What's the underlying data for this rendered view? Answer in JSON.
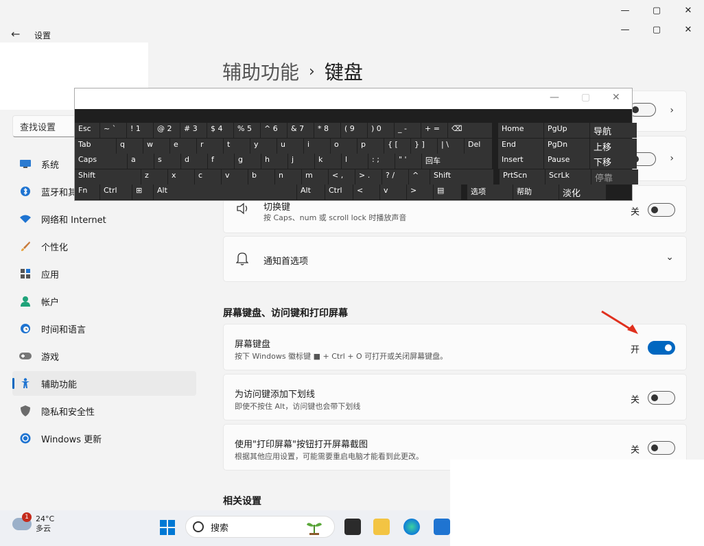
{
  "window": {
    "title": "设置",
    "controls": {
      "minimize": "—",
      "maximize": "▢",
      "close": "✕"
    }
  },
  "sidebar": {
    "search_placeholder": "查找设置",
    "items": [
      {
        "label": "系统",
        "icon": "monitor-icon"
      },
      {
        "label": "蓝牙和其",
        "icon": "bluetooth-icon"
      },
      {
        "label": "网络和 Internet",
        "icon": "wifi-icon"
      },
      {
        "label": "个性化",
        "icon": "brush-icon"
      },
      {
        "label": "应用",
        "icon": "apps-icon"
      },
      {
        "label": "帐户",
        "icon": "person-icon"
      },
      {
        "label": "时间和语言",
        "icon": "clock-globe-icon"
      },
      {
        "label": "游戏",
        "icon": "gamepad-icon"
      },
      {
        "label": "辅助功能",
        "icon": "accessibility-icon",
        "active": true
      },
      {
        "label": "隐私和安全性",
        "icon": "shield-icon"
      },
      {
        "label": "Windows 更新",
        "icon": "update-icon"
      }
    ]
  },
  "breadcrumb": {
    "parent": "辅助功能",
    "separator": "›",
    "current": "键盘"
  },
  "settings": {
    "sticky_card": {
      "title": "切换键",
      "desc": "按 Caps、num 或 scroll lock 时播放声音",
      "state": "关"
    },
    "notify_card": {
      "title": "通知首选项"
    },
    "section_title": "屏幕键盘、访问键和打印屏幕",
    "osk_card": {
      "title": "屏幕键盘",
      "desc": "按下 Windows 徽标键 ■ + Ctrl + O 可打开或关闭屏幕键盘。",
      "state": "开"
    },
    "underline_card": {
      "title": "为访问键添加下划线",
      "desc": "即使不按住 Alt，访问键也会带下划线",
      "state": "关"
    },
    "printscreen_card": {
      "title": "使用\"打印屏幕\"按钮打开屏幕截图",
      "desc": "根据其他应用设置，可能需要重启电脑才能看到此更改。",
      "state": "关"
    },
    "related_title": "相关设置"
  },
  "osk": {
    "row1": [
      "Esc",
      "~ `",
      "! 1",
      "@ 2",
      "# 3",
      "$ 4",
      "% 5",
      "^ 6",
      "& 7",
      "* 8",
      "( 9",
      ") 0",
      "_ -",
      "+ =",
      "⌫"
    ],
    "row2": [
      "Tab",
      "q",
      "w",
      "e",
      "r",
      "t",
      "y",
      "u",
      "i",
      "o",
      "p",
      "{ [",
      "} ]",
      "| \\",
      "Del"
    ],
    "row3": [
      "Caps",
      "a",
      "s",
      "d",
      "f",
      "g",
      "h",
      "j",
      "k",
      "l",
      ": ;",
      "\" '",
      "回车"
    ],
    "row4": [
      "Shift",
      "z",
      "x",
      "c",
      "v",
      "b",
      "n",
      "m",
      "< ,",
      "> .",
      "? /",
      "^",
      "Shift"
    ],
    "row5": [
      "Fn",
      "Ctrl",
      "⊞",
      "Alt",
      "",
      "Alt",
      "Ctrl",
      "<",
      "v",
      ">",
      "▤"
    ],
    "nav": [
      [
        "Home",
        "PgUp",
        "导航"
      ],
      [
        "End",
        "PgDn",
        "上移"
      ],
      [
        "Insert",
        "Pause",
        "下移"
      ],
      [
        "PrtScn",
        "ScrLk",
        "停靠"
      ],
      [
        "选项",
        "帮助",
        "淡化"
      ]
    ]
  },
  "taskbar": {
    "weather_temp": "24°C",
    "weather_desc": "多云",
    "weather_badge": "1",
    "search_label": "搜索"
  }
}
